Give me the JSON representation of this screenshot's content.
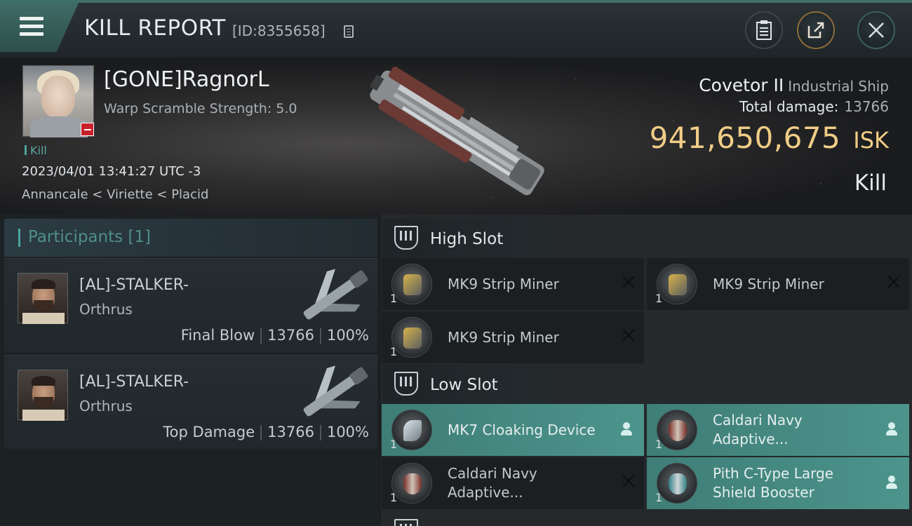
{
  "header": {
    "title": "KILL REPORT",
    "report_id": "[ID:8355658]"
  },
  "victim": {
    "name": "[GONE]RagnorL",
    "warp_scramble": "Warp Scramble Strength: 5.0",
    "tag": "Kill",
    "timestamp": "2023/04/01 13:41:27 UTC -3",
    "location": "Annancale < Viriette < Placid",
    "ship_name": "Covetor II",
    "ship_class": "Industrial Ship",
    "damage_label": "Total damage:",
    "damage_value": "13766",
    "isk_value": "941,650,675",
    "isk_unit": "ISK",
    "result": "Kill"
  },
  "participants": {
    "title": "Participants [1]",
    "items": [
      {
        "name": "[AL]-STALKER-",
        "ship": "Orthrus",
        "role": "Final Blow",
        "damage": "13766",
        "percent": "100%"
      },
      {
        "name": "[AL]-STALKER-",
        "ship": "Orthrus",
        "role": "Top Damage",
        "damage": "13766",
        "percent": "100%"
      }
    ]
  },
  "fitting": {
    "high_slot": {
      "title": "High Slot",
      "modules": [
        {
          "name": "MK9 Strip Miner",
          "qty": "1"
        },
        {
          "name": "MK9 Strip Miner",
          "qty": "1"
        },
        {
          "name": "MK9 Strip Miner",
          "qty": "1"
        }
      ]
    },
    "low_slot": {
      "title": "Low Slot",
      "modules": [
        {
          "name": "MK7 Cloaking Device",
          "qty": "1",
          "line2": ""
        },
        {
          "name": "Caldari Navy",
          "line2": "Adaptive...",
          "qty": "1"
        },
        {
          "name": "Caldari Navy",
          "line2": "Adaptive...",
          "qty": "1"
        },
        {
          "name": "Pith C-Type Large",
          "line2": "Shield Booster",
          "qty": "1"
        }
      ]
    }
  },
  "colors": {
    "accent_teal": "#4c948c",
    "isk_gold": "#f0cd86",
    "destroyed_red": "#c8202a"
  }
}
